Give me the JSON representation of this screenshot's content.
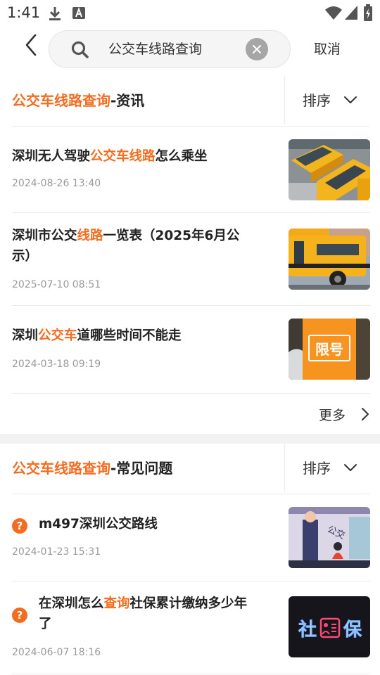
{
  "status_bar": {
    "time": "1:41",
    "icons": [
      "download-icon",
      "a-notification-icon",
      "wifi-icon",
      "signal-icon",
      "battery-icon"
    ]
  },
  "search": {
    "query": "公交车线路查询",
    "cancel_label": "取消"
  },
  "colors": {
    "accent": "#f36c1f",
    "divider": "#ececec",
    "muted_text": "#9a9a9a"
  },
  "news_section": {
    "title_highlight": "公交车线路查询",
    "title_suffix": "-资讯",
    "sort_label": "排序",
    "items": [
      {
        "pre": "深圳无人驾驶",
        "hl": "公交车线路",
        "post": "怎么乘坐",
        "date": "2024-08-26 13:40",
        "thumb": "yellow-buses-photo"
      },
      {
        "pre": "深圳市公交",
        "hl": "线路",
        "post": "一览表（2025年6月公示）",
        "date": "2025-07-10 08:51",
        "thumb": "school-bus-photo"
      },
      {
        "pre": "深圳",
        "hl": "公交车",
        "post": "道哪些时间不能走",
        "date": "2024-03-18 09:19",
        "thumb": "traffic-restriction-photo",
        "badge": "限号"
      }
    ],
    "more_label": "更多"
  },
  "faq_section": {
    "title_highlight": "公交车线路查询",
    "title_suffix": "-常见问题",
    "sort_label": "排序",
    "items": [
      {
        "pre": "m497深圳公交路线",
        "hl": "",
        "post": "",
        "date": "2024-01-23 15:31",
        "thumb": "bus-passenger-illustration",
        "badge": "公交"
      },
      {
        "pre": "在深圳怎么",
        "hl": "查询",
        "post": "社保累计缴纳多少年了",
        "date": "2024-06-07 18:16",
        "thumb": "social-security-neon-sign",
        "badge_left": "社",
        "badge_right": "保"
      }
    ]
  }
}
